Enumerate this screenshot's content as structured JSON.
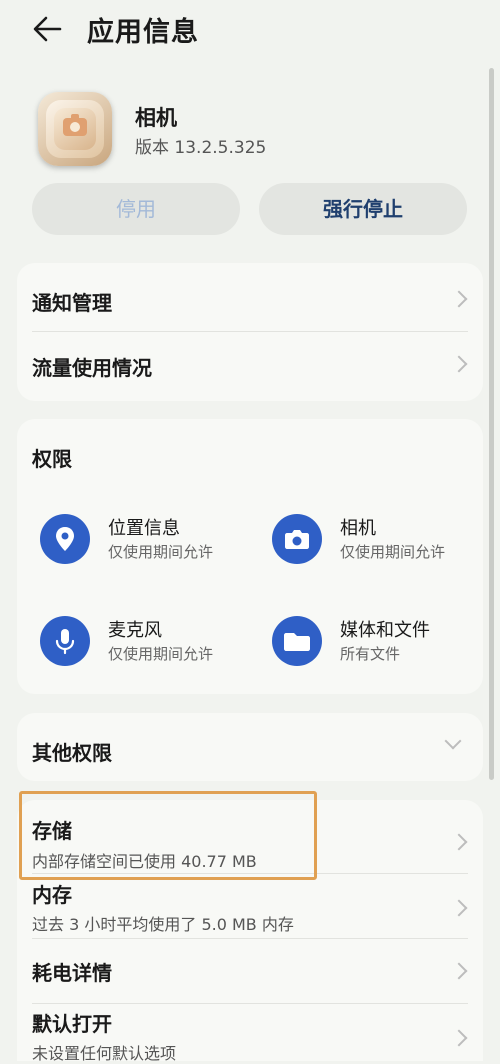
{
  "header": {
    "title": "应用信息"
  },
  "app": {
    "name": "相机",
    "version": "版本 13.2.5.325"
  },
  "actions": {
    "disable_label": "停用",
    "force_stop_label": "强行停止"
  },
  "menu1": {
    "notification": "通知管理",
    "traffic": "流量使用情况"
  },
  "permissions": {
    "title": "权限",
    "items": [
      {
        "name": "位置信息",
        "desc": "仅使用期间允许",
        "icon": "location-pin-icon"
      },
      {
        "name": "相机",
        "desc": "仅使用期间允许",
        "icon": "camera-icon"
      },
      {
        "name": "麦克风",
        "desc": "仅使用期间允许",
        "icon": "microphone-icon"
      },
      {
        "name": "媒体和文件",
        "desc": "所有文件",
        "icon": "folder-icon"
      }
    ]
  },
  "other_permissions": {
    "title": "其他权限"
  },
  "storage": {
    "title": "存储",
    "sub": "内部存储空间已使用 40.77 MB"
  },
  "memory": {
    "title": "内存",
    "sub": "过去 3 小时平均使用了 5.0 MB 内存"
  },
  "battery": {
    "title": "耗电详情"
  },
  "default_open": {
    "title": "默认打开",
    "sub": "未设置任何默认选项"
  },
  "colors": {
    "accent": "#2f5fc6",
    "highlight": "#e0a052",
    "background": "#f1f3ef"
  }
}
